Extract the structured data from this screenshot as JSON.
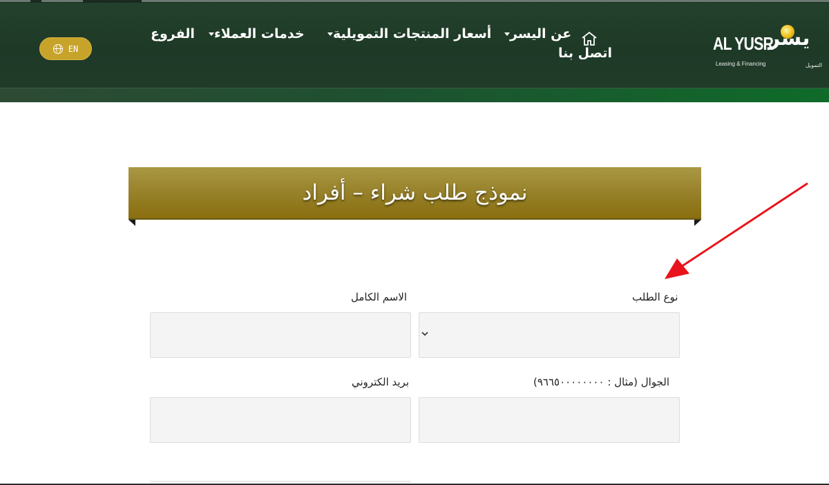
{
  "header": {
    "logo": {
      "latin": "AL YUSR",
      "latin_sub": "Leasing & Financing",
      "arabic": "يسر",
      "arabic_sub": "التمويل"
    },
    "nav": {
      "home_contact": "اتصل بنا",
      "about": "عن اليسر",
      "products": "أسعار المنتجات التمويلية",
      "services": "خدمات العملاء",
      "branches": "الفروع"
    },
    "lang_button": "EN",
    "colors": {
      "header_bg": "#1e3a27",
      "accent_green": "#0f6b2a",
      "gold": "#c7a32a"
    }
  },
  "banner": {
    "title": "نموذج طلب شراء – أفراد",
    "color": "#957f27"
  },
  "form": {
    "request_type_label": "نوع الطلب",
    "full_name_label": "الاسم الكامل",
    "mobile_label": "الجوال (مثال : ٩٦٦٥٠٠٠٠٠٠٠٠)",
    "email_label": "بريد الكتروني",
    "request_type_value": "",
    "full_name_value": "",
    "mobile_value": "",
    "email_value": ""
  },
  "annotation": {
    "arrow_color": "#e8131b"
  }
}
